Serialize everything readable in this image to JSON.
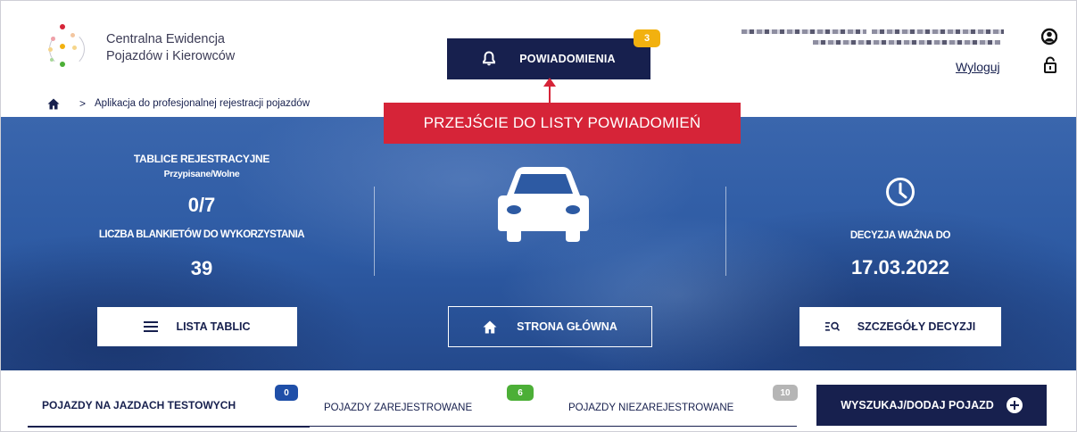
{
  "header": {
    "brand_line1": "Centralna Ewidencja",
    "brand_line2": "Pojazdów i Kierowców",
    "notifications_label": "POWIADOMIENIA",
    "notifications_count": "3",
    "logout_label": "Wyloguj"
  },
  "callout": {
    "text": "PRZEJŚCIE DO LISTY POWIADOMIEŃ"
  },
  "breadcrumb": {
    "current": "Aplikacja do profesjonalnej rejestracji pojazdów"
  },
  "hero": {
    "plates_title": "TABLICE REJESTRACYJNE",
    "plates_subtitle": "Przypisane/Wolne",
    "plates_value": "0/7",
    "blanks_title": "LICZBA BLANKIETÓW DO WYKORZYSTANIA",
    "blanks_value": "39",
    "decision_title": "DECYZJA WAŻNA DO",
    "decision_date": "17.03.2022",
    "btn_plates_list": "LISTA TABLIC",
    "btn_home": "STRONA GŁÓWNA",
    "btn_decision_details": "SZCZEGÓŁY DECYZJI"
  },
  "tabs": [
    {
      "label": "POJAZDY NA JAZDACH TESTOWYCH",
      "count": "0",
      "badge_color": "#1f4fa8"
    },
    {
      "label": "POJAZDY ZAREJESTROWANE",
      "count": "6",
      "badge_color": "#4caf37"
    },
    {
      "label": "POJAZDY NIEZAREJESTROWANE",
      "count": "10",
      "badge_color": "#b5b5b5"
    }
  ],
  "search_add_label": "WYSZUKAJ/DODAJ POJAZD",
  "colors": {
    "navy": "#17204e",
    "callout_red": "#d62438",
    "notification_badge": "#f2b10f",
    "hero_blue": "#2d5aa3"
  }
}
